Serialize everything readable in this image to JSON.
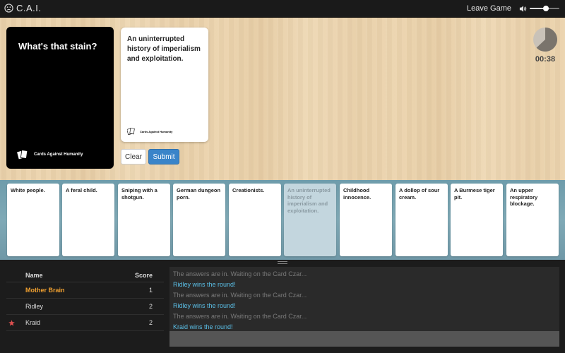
{
  "app": {
    "title": "C.A.I.",
    "icon": "frown-face-icon"
  },
  "header": {
    "leave_label": "Leave Game",
    "volume_level": 0.55
  },
  "black_card": {
    "text": "What's that stain?",
    "brand": "Cards Against Humanity"
  },
  "played_card": {
    "text": "An uninterrupted history of imperialism and exploitation.",
    "brand": "Cards Against Humanity"
  },
  "actions": {
    "clear_label": "Clear",
    "submit_label": "Submit"
  },
  "timer": {
    "display": "00:38",
    "remaining_fraction": 0.63
  },
  "hand": [
    {
      "text": "White people.",
      "selected": false
    },
    {
      "text": "A feral child.",
      "selected": false
    },
    {
      "text": "Sniping with a shotgun.",
      "selected": false
    },
    {
      "text": "German dungeon porn.",
      "selected": false
    },
    {
      "text": "Creationists.",
      "selected": false
    },
    {
      "text": "An uninterrupted history of imperialism and exploitation.",
      "selected": true
    },
    {
      "text": "Childhood innocence.",
      "selected": false
    },
    {
      "text": "A dollop of sour cream.",
      "selected": false
    },
    {
      "text": "A Burmese tiger pit.",
      "selected": false
    },
    {
      "text": "An upper respiratory blockage.",
      "selected": false
    }
  ],
  "scoreboard": {
    "name_header": "Name",
    "score_header": "Score",
    "players": [
      {
        "name": "Mother Brain",
        "score": "1",
        "highlight": true,
        "czar": false
      },
      {
        "name": "Ridley",
        "score": "2",
        "highlight": false,
        "czar": false
      },
      {
        "name": "Kraid",
        "score": "2",
        "highlight": false,
        "czar": true
      }
    ]
  },
  "chat": {
    "messages": [
      {
        "text": "The answers are in. Waiting on the Card Czar...",
        "kind": "system"
      },
      {
        "text": "Ridley wins the round!",
        "kind": "win"
      },
      {
        "text": "The answers are in. Waiting on the Card Czar...",
        "kind": "system"
      },
      {
        "text": "Ridley wins the round!",
        "kind": "win"
      },
      {
        "text": "The answers are in. Waiting on the Card Czar...",
        "kind": "system"
      },
      {
        "text": "Kraid wins the round!",
        "kind": "win"
      }
    ],
    "input_value": ""
  },
  "colors": {
    "accent": "#3a84c9",
    "highlight_player": "#f0a030",
    "win_message": "#5bc0e8",
    "czar_star": "#e05050"
  }
}
